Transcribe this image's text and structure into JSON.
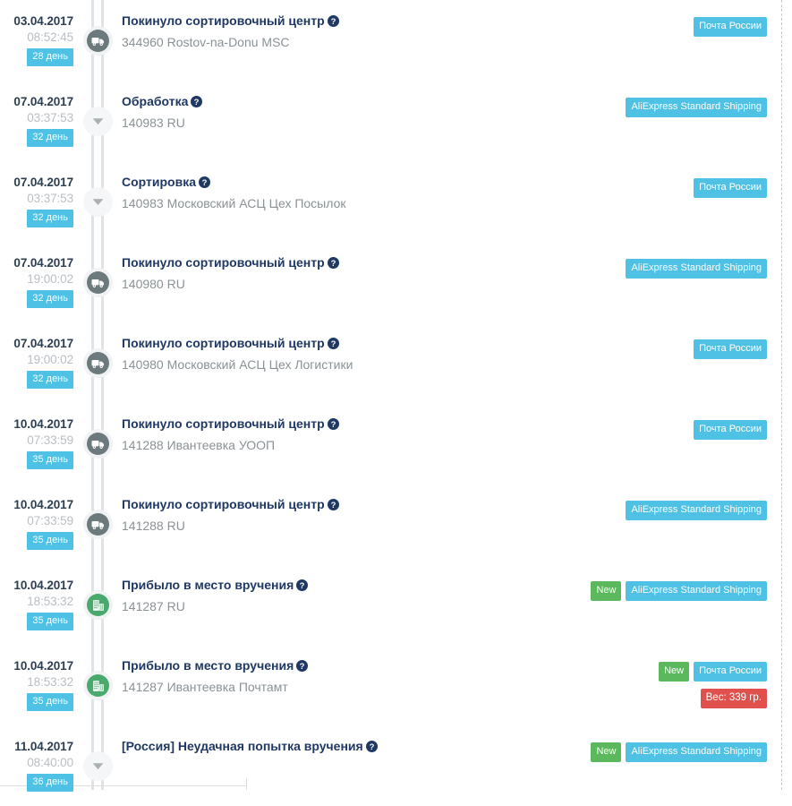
{
  "page": {
    "title": "Package tracking history",
    "accent_blue": "#4fc1e4",
    "accent_green": "#5cb85c",
    "accent_red": "#e0504c",
    "title_color": "#1f3864",
    "muted_color": "#8a9296"
  },
  "labels": {
    "help_icon": "help-icon",
    "truck_icon": "truck-icon",
    "building_icon": "building-icon",
    "chevron_down_icon": "chevron-down-icon"
  },
  "events": [
    {
      "date": "03.04.2017",
      "time": "08:52:45",
      "day_badge": "28 день",
      "title": "Покинуло сортировочный центр",
      "location": "344960 Rostov-na-Donu MSC",
      "marker": "truck",
      "badges": [
        {
          "text": "Почта России",
          "kind": "carrier"
        }
      ],
      "weight_badge": null,
      "redaction": null
    },
    {
      "date": "07.04.2017",
      "time": "03:37:53",
      "day_badge": "32 день",
      "title": "Обработка",
      "location": "140983 RU",
      "marker": "collapse",
      "badges": [
        {
          "text": "AliExpress Standard Shipping",
          "kind": "carrier"
        }
      ],
      "weight_badge": null,
      "redaction": null
    },
    {
      "date": "07.04.2017",
      "time": "03:37:53",
      "day_badge": "32 день",
      "title": "Сортировка",
      "location": "140983 Московский АСЦ Цех Посылок",
      "marker": "collapse",
      "badges": [
        {
          "text": "Почта России",
          "kind": "carrier"
        }
      ],
      "weight_badge": null,
      "redaction": null
    },
    {
      "date": "07.04.2017",
      "time": "19:00:02",
      "day_badge": "32 день",
      "title": "Покинуло сортировочный центр",
      "location": "140980 RU",
      "marker": "truck",
      "badges": [
        {
          "text": "AliExpress Standard Shipping",
          "kind": "carrier"
        }
      ],
      "weight_badge": null,
      "redaction": null
    },
    {
      "date": "07.04.2017",
      "time": "19:00:02",
      "day_badge": "32 день",
      "title": "Покинуло сортировочный центр",
      "location": "140980 Московский АСЦ Цех Логистики",
      "marker": "truck",
      "badges": [
        {
          "text": "Почта России",
          "kind": "carrier"
        }
      ],
      "weight_badge": null,
      "redaction": null
    },
    {
      "date": "10.04.2017",
      "time": "07:33:59",
      "day_badge": "35 день",
      "title": "Покинуло сортировочный центр",
      "location": "141288 Ивантеевка УООП",
      "marker": "truck",
      "badges": [
        {
          "text": "Почта России",
          "kind": "carrier"
        }
      ],
      "weight_badge": null,
      "redaction": null
    },
    {
      "date": "10.04.2017",
      "time": "07:33:59",
      "day_badge": "35 день",
      "title": "Покинуло сортировочный центр",
      "location": "141288 RU",
      "marker": "truck",
      "badges": [
        {
          "text": "AliExpress Standard Shipping",
          "kind": "carrier"
        }
      ],
      "weight_badge": null,
      "redaction": null
    },
    {
      "date": "10.04.2017",
      "time": "18:53:32",
      "day_badge": "35 день",
      "title": "Прибыло в место вручения",
      "location": "141287 RU",
      "marker": "arrive",
      "badges": [
        {
          "text": "New",
          "kind": "new"
        },
        {
          "text": "AliExpress Standard Shipping",
          "kind": "carrier"
        }
      ],
      "weight_badge": null,
      "redaction": "short"
    },
    {
      "date": "10.04.2017",
      "time": "18:53:32",
      "day_badge": "35 день",
      "title": "Прибыло в место вручения",
      "location": "141287 Ивантеевка Почтамт",
      "marker": "arrive",
      "badges": [
        {
          "text": "New",
          "kind": "new"
        },
        {
          "text": "Почта России",
          "kind": "carrier"
        }
      ],
      "weight_badge": {
        "text": "Вес: 339 гр.",
        "kind": "weight"
      },
      "redaction": "long"
    },
    {
      "date": "11.04.2017",
      "time": "08:40:00",
      "day_badge": "36 день",
      "title": "[Россия] Неудачная попытка вручения",
      "location": "",
      "marker": "collapse",
      "badges": [
        {
          "text": "New",
          "kind": "new"
        },
        {
          "text": "AliExpress Standard Shipping",
          "kind": "carrier"
        }
      ],
      "weight_badge": null,
      "redaction": null
    }
  ]
}
